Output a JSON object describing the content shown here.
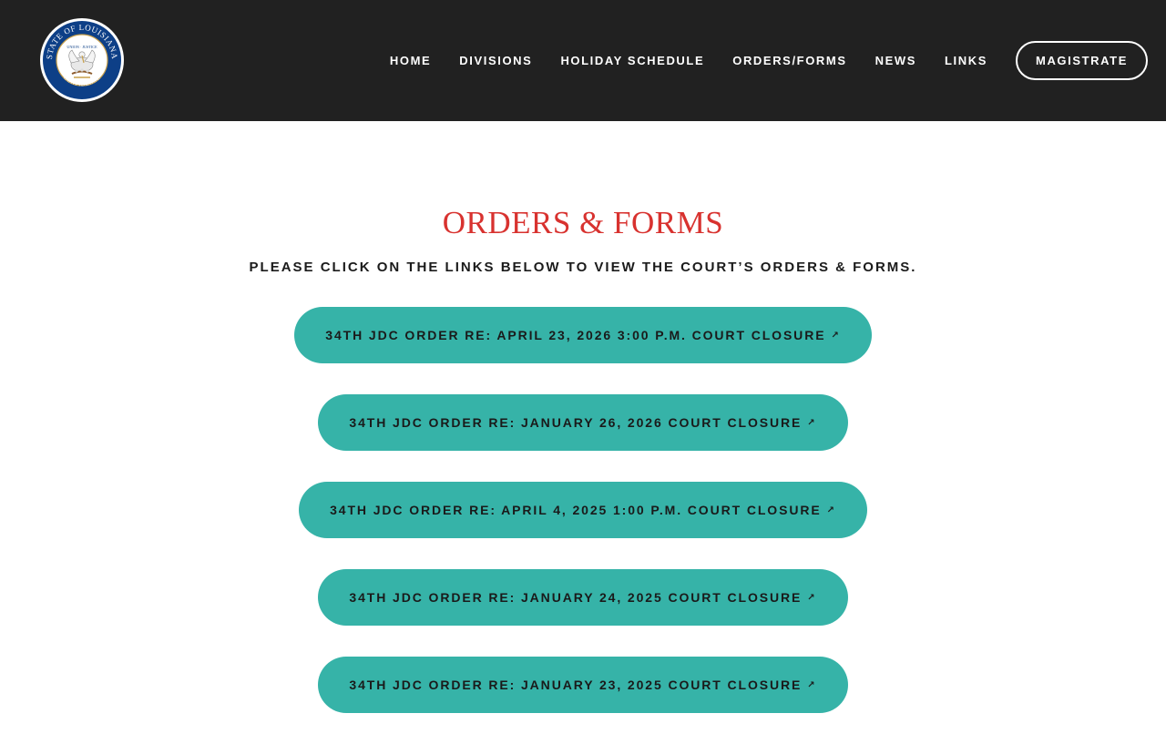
{
  "header": {
    "logo": {
      "name": "state-of-louisiana-seal",
      "ring_text_top": "STATE OF LOUISIANA",
      "inner_text": "UNION · JUSTICE",
      "ring_text_bottom": "CONFIDENCE",
      "colors": {
        "ring": "#0d3f87",
        "inner": "#ffffff",
        "gold": "#c8a04a"
      }
    },
    "nav": [
      {
        "label": "HOME"
      },
      {
        "label": "DIVISIONS"
      },
      {
        "label": "HOLIDAY SCHEDULE"
      },
      {
        "label": "ORDERS/FORMS"
      },
      {
        "label": "NEWS"
      },
      {
        "label": "LINKS"
      }
    ],
    "cta": {
      "label": "MAGISTRATE"
    }
  },
  "main": {
    "title": "ORDERS & FORMS",
    "subtitle": "PLEASE CLICK ON THE LINKS BELOW TO VIEW THE COURT’S ORDERS & FORMS.",
    "orders": [
      {
        "label": "34TH JDC ORDER RE: APRIL 23, 2026 3:00 P.M. COURT CLOSURE",
        "icon": "external-link-icon"
      },
      {
        "label": "34TH JDC ORDER RE: JANUARY 26, 2026 COURT CLOSURE",
        "icon": "external-link-icon"
      },
      {
        "label": "34TH JDC ORDER RE: APRIL 4, 2025 1:00 P.M. COURT CLOSURE",
        "icon": "external-link-icon"
      },
      {
        "label": "34TH JDC ORDER RE: JANUARY 24, 2025 COURT CLOSURE",
        "icon": "external-link-icon"
      },
      {
        "label": "34TH JDC ORDER RE: JANUARY 23, 2025 COURT CLOSURE",
        "icon": "external-link-icon"
      }
    ],
    "ext_glyph": "↗"
  },
  "colors": {
    "header_bg": "#212121",
    "title": "#d8322f",
    "button_bg": "#36b3a8",
    "button_text": "#1a1a1a"
  }
}
